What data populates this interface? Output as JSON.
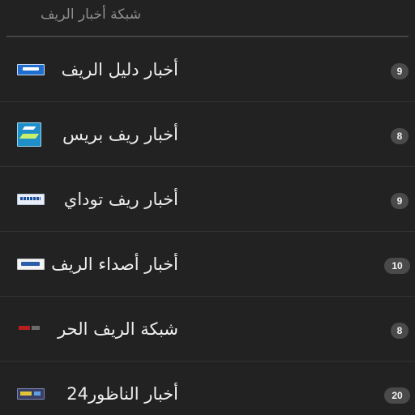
{
  "header": {
    "title": "شبكة أخبار الريف"
  },
  "feeds": [
    {
      "title": "أخبار دليل الريف",
      "count": "9",
      "logo": "dalil-rif-logo"
    },
    {
      "title": "أخبار ريف بريس",
      "count": "8",
      "logo": "rif-press-logo"
    },
    {
      "title": "أخبار ريف توداي",
      "count": "9",
      "logo": "rif-today-logo"
    },
    {
      "title": "أخبار أصداء الريف",
      "count": "10",
      "logo": "asdaa-rif-logo"
    },
    {
      "title": "شبكة الريف الحر",
      "count": "8",
      "logo": "rif-horr-logo"
    },
    {
      "title": "أخبار الناظور24",
      "count": "20",
      "logo": "nador24-logo"
    }
  ]
}
